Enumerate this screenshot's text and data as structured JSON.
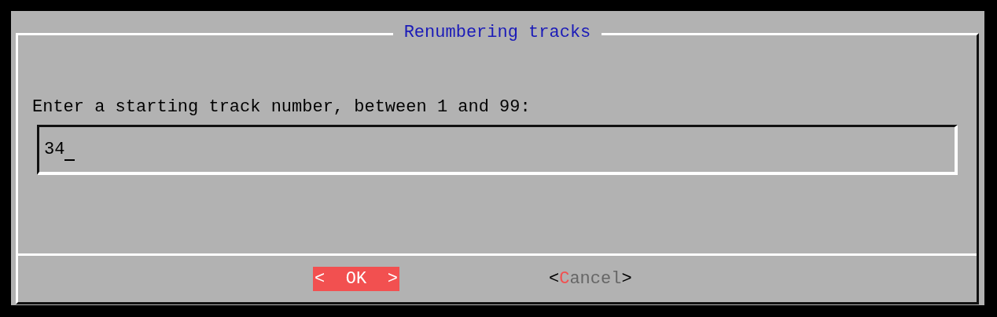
{
  "dialog": {
    "title": "Renumbering tracks",
    "prompt": "Enter a starting track number, between 1 and 99:",
    "input": {
      "value": "34"
    }
  },
  "buttons": [
    {
      "left": "<",
      "hotkey": "O",
      "rest": "K",
      "right": ">",
      "selected": true
    },
    {
      "left": "<",
      "hotkey": "C",
      "rest": "ancel",
      "right": ">",
      "selected": false
    }
  ]
}
